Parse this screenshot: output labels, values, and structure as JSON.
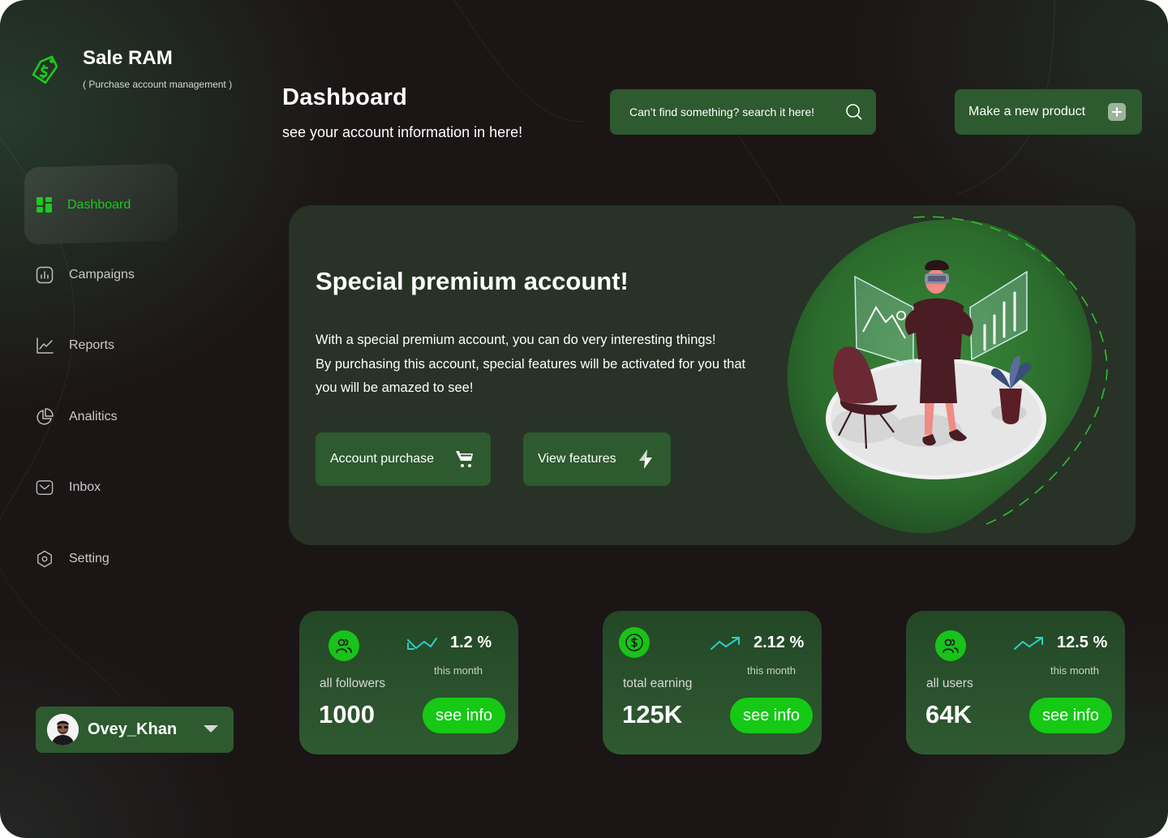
{
  "brand": {
    "name": "Sale RAM",
    "subtitle": "( Purchase account management )"
  },
  "header": {
    "title": "Dashboard",
    "subtitle": "see your account information in here!",
    "search_placeholder": "Can’t find something? search it here!",
    "new_product_label": "Make a new product"
  },
  "sidebar": {
    "items": [
      {
        "label": "Dashboard",
        "icon": "grid-icon",
        "active": true
      },
      {
        "label": "Campaigns",
        "icon": "bar-chart-icon"
      },
      {
        "label": "Reports",
        "icon": "line-chart-icon"
      },
      {
        "label": "Analitics",
        "icon": "pie-chart-icon"
      },
      {
        "label": "Inbox",
        "icon": "inbox-icon"
      },
      {
        "label": "Setting",
        "icon": "hexagon-settings-icon"
      }
    ]
  },
  "user": {
    "name": "Ovey_Khan"
  },
  "banner": {
    "title": "Special premium account!",
    "lines": [
      "With a special premium account, you can do very interesting things!",
      "By purchasing this account, special features will be activated for you that",
      "you will be amazed to see!"
    ],
    "purchase_label": "Account purchase",
    "features_label": "View features"
  },
  "stats": [
    {
      "label": "all followers",
      "value": "1000",
      "change": "1.2 %",
      "period": "this month",
      "button": "see info",
      "icon": "users-icon",
      "trend": "trend-down-up-icon"
    },
    {
      "label": "total earning",
      "value": "125K",
      "change": "2.12 %",
      "period": "this month",
      "button": "see info",
      "icon": "dollar-coin-icon",
      "trend": "trend-up-icon"
    },
    {
      "label": "all users",
      "value": "64K",
      "change": "12.5 %",
      "period": "this month",
      "button": "see info",
      "icon": "users-icon",
      "trend": "trend-up-icon"
    }
  ],
  "colors": {
    "background": "#1c1516",
    "panel_green": "#2d5a2e",
    "accent_green": "#19c319",
    "banner_bg": "#283227",
    "teal_trend": "#2ad0c8"
  }
}
